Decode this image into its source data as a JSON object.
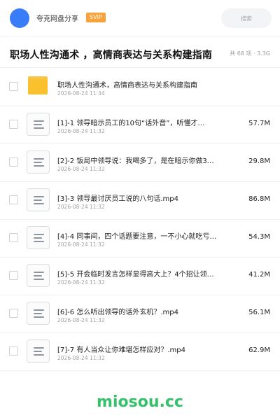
{
  "header": {
    "share_name": "夸克网盘分享",
    "badge": "SVIP",
    "search_placeholder": "搜索"
  },
  "folder": {
    "title": "职场人性沟通术 ，高情商表达与关系构建指南",
    "meta": "共 68 项 · 3.3G"
  },
  "items": [
    {
      "type": "folder",
      "name": "职场人性沟通术，高情商表达与关系构建指南",
      "date": "2026-08-24 11:34",
      "size": ""
    },
    {
      "type": "file",
      "name": "[1]-1 领导暗示员工的10句“话外音”，听懂才…",
      "date": "2026-08-24 11:32",
      "size": "57.7M"
    },
    {
      "type": "file",
      "name": "[2]-2 饭局中领导说：我喝多了，是在暗示你做3…",
      "date": "2026-08-24 11:32",
      "size": "29.8M"
    },
    {
      "type": "file",
      "name": "[3]-3 领导最讨厌员工说的八句话.mp4",
      "date": "2026-08-24 11:32",
      "size": "86.8M"
    },
    {
      "type": "file",
      "name": "[4]-4 同事间，四个话题要注意，一不小心就吃亏…",
      "date": "2026-08-24 11:32",
      "size": "54.3M"
    },
    {
      "type": "file",
      "name": "[5]-5 开会临时发言怎样显得高大上？4个招让领…",
      "date": "2026-08-24 11:32",
      "size": "41.2M"
    },
    {
      "type": "file",
      "name": "[6]-6 怎么听出领导的话外玄机？.mp4",
      "date": "2026-08-24 11:32",
      "size": "56.1M"
    },
    {
      "type": "file",
      "name": "[7]-7 有人当众让你难堪怎样应对？.mp4",
      "date": "2026-08-24 11:32",
      "size": "62.9M"
    }
  ],
  "watermark": "miosou.cc",
  "colors": {
    "accent": "#3a7cf7",
    "svip": "#f7a23b",
    "folder": "#fbc02d",
    "watermark": "#35c16a"
  }
}
